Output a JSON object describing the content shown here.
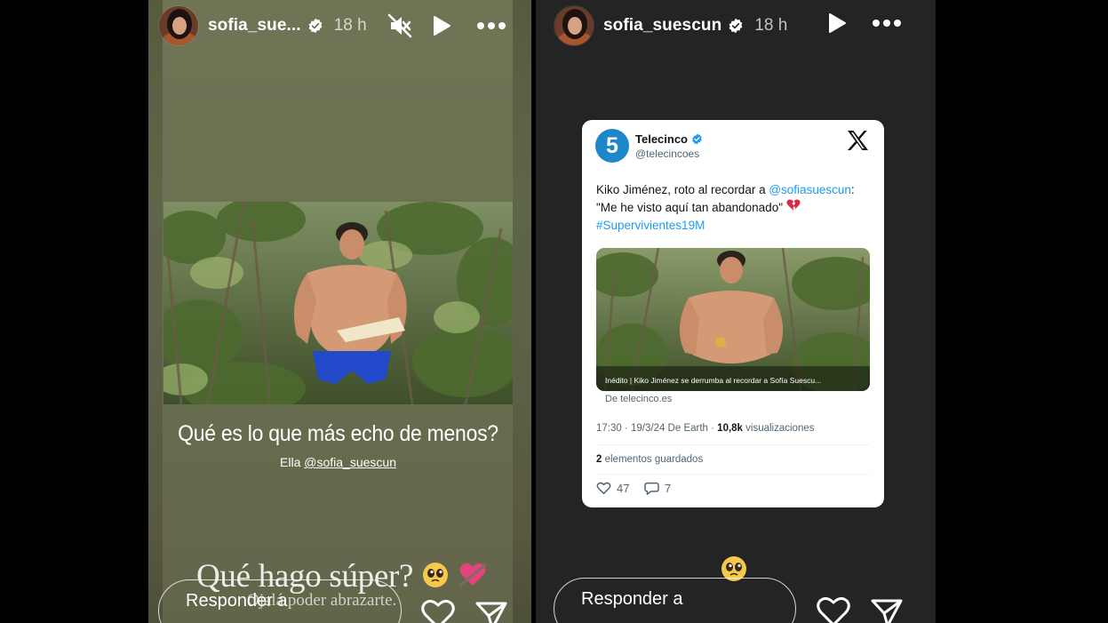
{
  "left_story": {
    "username": "sofia_sue...",
    "time": "18 h",
    "question": "Qué es lo que más echo de menos?",
    "mention_prefix": "Ella",
    "mention_handle": "@sofia_suescun",
    "script_text": "Qué hago súper?",
    "script_sub": "Ojalá poder abrazarte.",
    "reply_placeholder": "Responder a"
  },
  "right_story": {
    "username": "sofia_suescun",
    "time": "18 h",
    "reply_placeholder": "Responder a",
    "tweet": {
      "logo_text": "5",
      "name": "Telecinco",
      "handle": "@telecincoes",
      "text_1": "Kiko Jiménez, roto al recordar a ",
      "text_mention": "@sofiasuescun",
      "text_2": ":",
      "text_line2": "\"Me he visto aquí tan abandonado\"",
      "hashtag": "#Supervivientes19M",
      "media_caption": "Inédito | Kiko Jiménez se derrumba al recordar a Sofía Suescu...",
      "source": "De telecinco.es",
      "meta_time": "17:30 · 19/3/24 De Earth · ",
      "meta_views": "10,8k",
      "meta_views_label": " visualizaciones",
      "saved_count": "2",
      "saved_label": " elementos guardados",
      "likes": "47",
      "replies": "7"
    }
  },
  "colors": {
    "verified_blue": "#1d9bf0",
    "telecinco_blue": "#1d87c9",
    "left_bg": "#6a6f50",
    "right_bg": "#242424"
  }
}
